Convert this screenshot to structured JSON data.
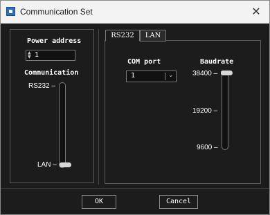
{
  "window": {
    "title": "Communication Set",
    "close_glyph": "✕"
  },
  "left": {
    "power_address_label": "Power address",
    "power_address_value": "1",
    "communication_label": "Communication",
    "slider_top_label": "RS232",
    "slider_bottom_label": "LAN",
    "selected": "LAN"
  },
  "tabs": [
    {
      "label": "RS232",
      "active": true
    },
    {
      "label": "LAN",
      "active": false
    }
  ],
  "rs232": {
    "com_port_label": "COM port",
    "com_port_value": "1",
    "baudrate_label": "Baudrate",
    "baud_ticks": [
      "38400",
      "19200",
      "9600"
    ],
    "baud_selected": "38400"
  },
  "buttons": {
    "ok": "OK",
    "cancel": "Cancel"
  }
}
